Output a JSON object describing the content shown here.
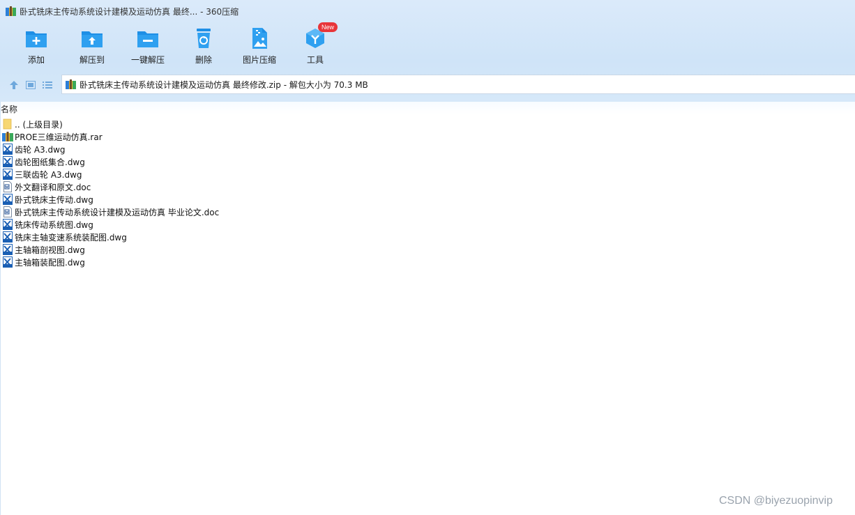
{
  "window": {
    "title": "卧式铣床主传动系统设计建模及运动仿真 最终... - 360压缩"
  },
  "toolbar": {
    "items": [
      {
        "label": "添加",
        "icon": "add-folder-icon"
      },
      {
        "label": "解压到",
        "icon": "extract-to-icon"
      },
      {
        "label": "一键解压",
        "icon": "one-click-extract-icon"
      },
      {
        "label": "删除",
        "icon": "trash-icon"
      },
      {
        "label": "图片压缩",
        "icon": "image-compress-icon"
      },
      {
        "label": "工具",
        "icon": "tools-icon",
        "badge": "New"
      }
    ]
  },
  "navbar": {
    "path": "卧式铣床主传动系统设计建模及运动仿真 最终修改.zip - 解包大小为 70.3 MB"
  },
  "list": {
    "header_name": "名称",
    "files": [
      {
        "name": ".. (上级目录)",
        "type": "folder"
      },
      {
        "name": "PROE三维运动仿真.rar",
        "type": "archive"
      },
      {
        "name": "齿轮 A3.dwg",
        "type": "dwg"
      },
      {
        "name": "齿轮图纸集合.dwg",
        "type": "dwg"
      },
      {
        "name": "三联齿轮 A3.dwg",
        "type": "dwg"
      },
      {
        "name": "外文翻译和原文.doc",
        "type": "doc"
      },
      {
        "name": "卧式铣床主传动.dwg",
        "type": "dwg"
      },
      {
        "name": "卧式铣床主传动系统设计建模及运动仿真 毕业论文.doc",
        "type": "doc"
      },
      {
        "name": "铣床传动系统图.dwg",
        "type": "dwg"
      },
      {
        "name": "铣床主轴变速系统装配图.dwg",
        "type": "dwg"
      },
      {
        "name": "主轴箱剖视图.dwg",
        "type": "dwg"
      },
      {
        "name": "主轴箱装配图.dwg",
        "type": "dwg"
      }
    ]
  },
  "watermark": "CSDN @biyezuopinvip",
  "colors": {
    "accent": "#1e8fe6",
    "badge": "#e8353a",
    "toolbar_bg": "#d3e6f9"
  }
}
